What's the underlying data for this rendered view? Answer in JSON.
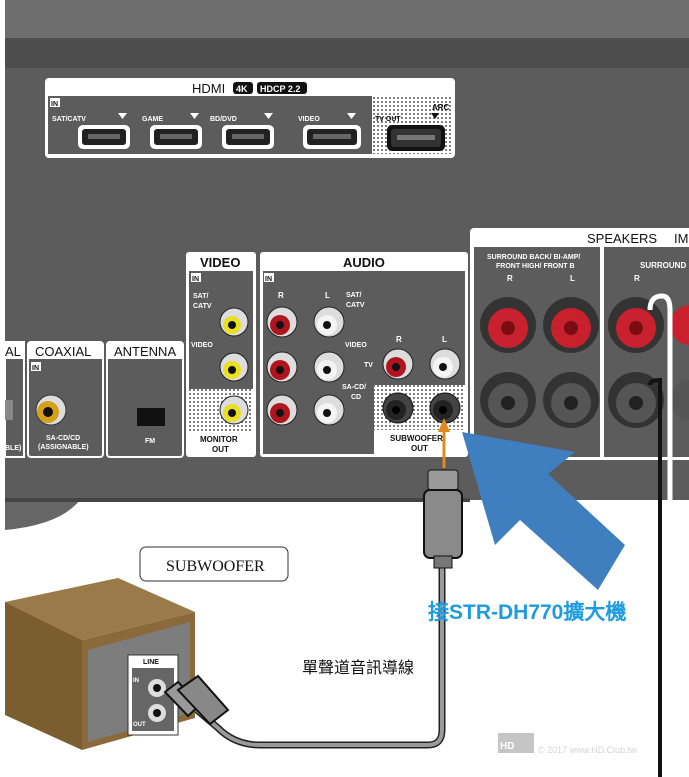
{
  "hdmi": {
    "title": "HDMI",
    "badge_4k": "4K",
    "badge_hdcp": "HDCP 2.2",
    "in_label": "IN",
    "inputs": [
      "SAT/CATV",
      "GAME",
      "BD/DVD",
      "VIDEO"
    ],
    "tv_out": "TV OUT",
    "arc": "ARC"
  },
  "optical_partial": {
    "title": "AL",
    "sub": "BLE)"
  },
  "coaxial": {
    "title": "COAXIAL",
    "in_label": "IN",
    "line1": "SA-CD/CD",
    "line2": "(ASSIGNABLE)"
  },
  "antenna": {
    "title": "ANTENNA",
    "fm": "FM"
  },
  "video": {
    "title": "VIDEO",
    "in_label": "IN",
    "sat1": "SAT/",
    "sat2": "CATV",
    "video": "VIDEO",
    "monitor1": "MONITOR",
    "monitor2": "OUT"
  },
  "audio": {
    "title": "AUDIO",
    "in_label": "IN",
    "r": "R",
    "l": "L",
    "sat1": "SAT/",
    "sat2": "CATV",
    "video": "VIDEO",
    "tv": "TV",
    "sacd1": "SA-CD/",
    "sacd2": "CD",
    "sub1": "SUBWOOFER",
    "sub2": "OUT"
  },
  "speakers": {
    "title": "SPEAKERS",
    "imp": "IM",
    "group1_line1": "SURROUND BACK/ BI-AMP/",
    "group1_line2": "FRONT HIGH/ FRONT B",
    "r": "R",
    "l": "L",
    "group2": "SURROUND"
  },
  "subwoofer": {
    "label": "SUBWOOFER",
    "line": "LINE",
    "in": "IN",
    "out": "OUT"
  },
  "annotations": {
    "connect": "接STR-DH770擴大機",
    "cable": "單聲道音訊導線"
  },
  "watermark": {
    "logo": "HD CLUB",
    "text": "© 2017 www.HD.Club.tw"
  },
  "colors": {
    "arrow_blue": "#3f7fc0",
    "annotation_blue": "#1f9be0",
    "orange_arrow": "#e08a1e",
    "panel": "#5c5c5c"
  }
}
